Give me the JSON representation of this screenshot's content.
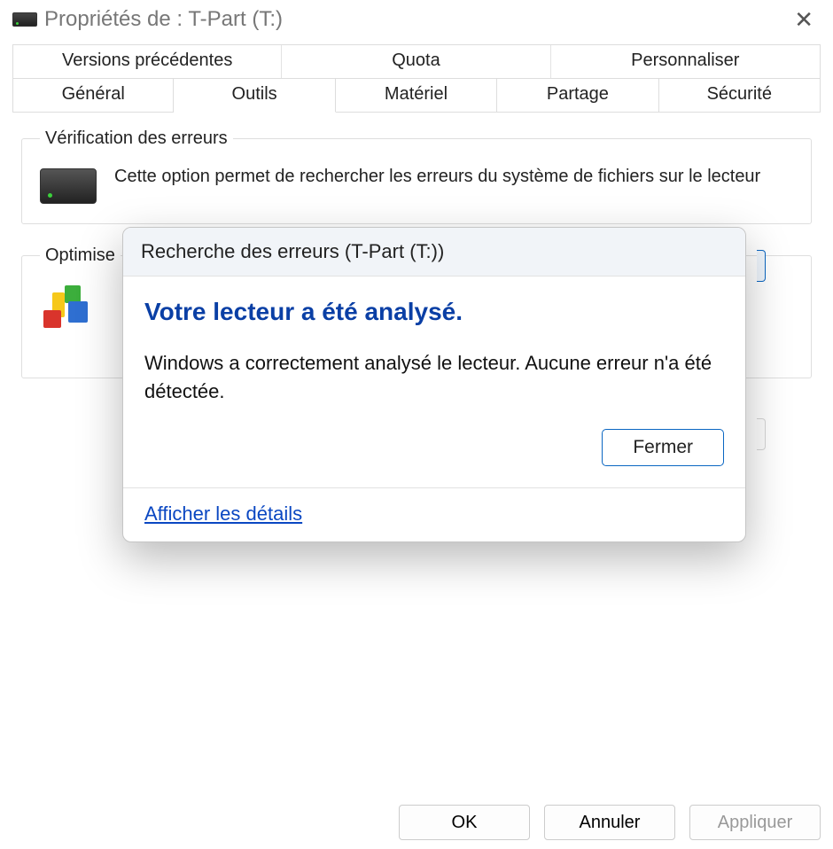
{
  "window": {
    "title": "Propriétés de : T-Part (T:)"
  },
  "tabs_row1": [
    {
      "label": "Versions précédentes"
    },
    {
      "label": "Quota"
    },
    {
      "label": "Personnaliser"
    }
  ],
  "tabs_row2": [
    {
      "label": "Général"
    },
    {
      "label": "Outils",
      "active": true
    },
    {
      "label": "Matériel"
    },
    {
      "label": "Partage"
    },
    {
      "label": "Sécurité"
    }
  ],
  "groups": {
    "errors": {
      "legend": "Vérification des erreurs",
      "text": "Cette option permet de rechercher les erreurs du système de fichiers sur le lecteur"
    },
    "optimize": {
      "legend": "Optimise"
    }
  },
  "buttons": {
    "ok": "OK",
    "cancel": "Annuler",
    "apply": "Appliquer"
  },
  "modal": {
    "header": "Recherche des erreurs (T-Part (T:))",
    "title": "Votre lecteur a été analysé.",
    "text": "Windows a correctement analysé le lecteur. Aucune erreur n'a été détectée.",
    "close": "Fermer",
    "details": "Afficher les détails"
  }
}
